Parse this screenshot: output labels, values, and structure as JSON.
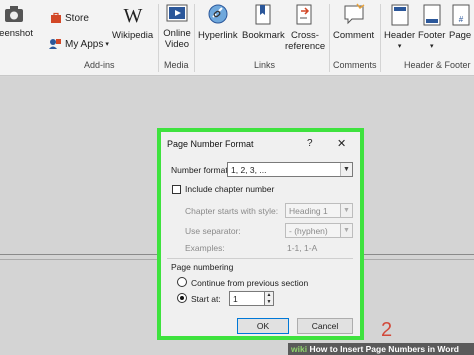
{
  "ribbon": {
    "screenshot_label": "reenshot",
    "store_label": "Store",
    "my_apps_label": "My Apps",
    "wikipedia_label": "Wikipedia",
    "online_video_label": "Online Video",
    "hyperlink_label": "Hyperlink",
    "bookmark_label": "Bookmark",
    "cross_reference_label": "Cross-reference",
    "comment_label": "Comment",
    "header_label": "Header",
    "footer_label": "Footer",
    "page_number_label": "Page Numb",
    "groups": {
      "addins": "Add-ins",
      "media": "Media",
      "links": "Links",
      "comments": "Comments",
      "header_footer": "Header & Footer"
    },
    "colors": {
      "store_icon": "#d24726",
      "video_icon": "#2b579a",
      "accent": "#2b579a"
    }
  },
  "dialog": {
    "title": "Page Number Format",
    "help": "?",
    "close": "✕",
    "number_format_label": "Number format:",
    "number_format_value": "1, 2, 3, ...",
    "include_chapter_label": "Include chapter number",
    "chapter_style_label": "Chapter starts with style:",
    "chapter_style_value": "Heading 1",
    "separator_label": "Use separator:",
    "separator_value": "-   (hyphen)",
    "examples_label": "Examples:",
    "examples_value": "1-1, 1-A",
    "page_numbering_label": "Page numbering",
    "continue_label": "Continue from previous section",
    "start_at_label": "Start at:",
    "start_at_value": "1",
    "ok_label": "OK",
    "cancel_label": "Cancel",
    "highlight_color": "#3ee23e"
  },
  "overlay": {
    "step_number": "2",
    "caption_brand": "wiki",
    "caption_text": "How to Insert Page Numbers in Word"
  }
}
